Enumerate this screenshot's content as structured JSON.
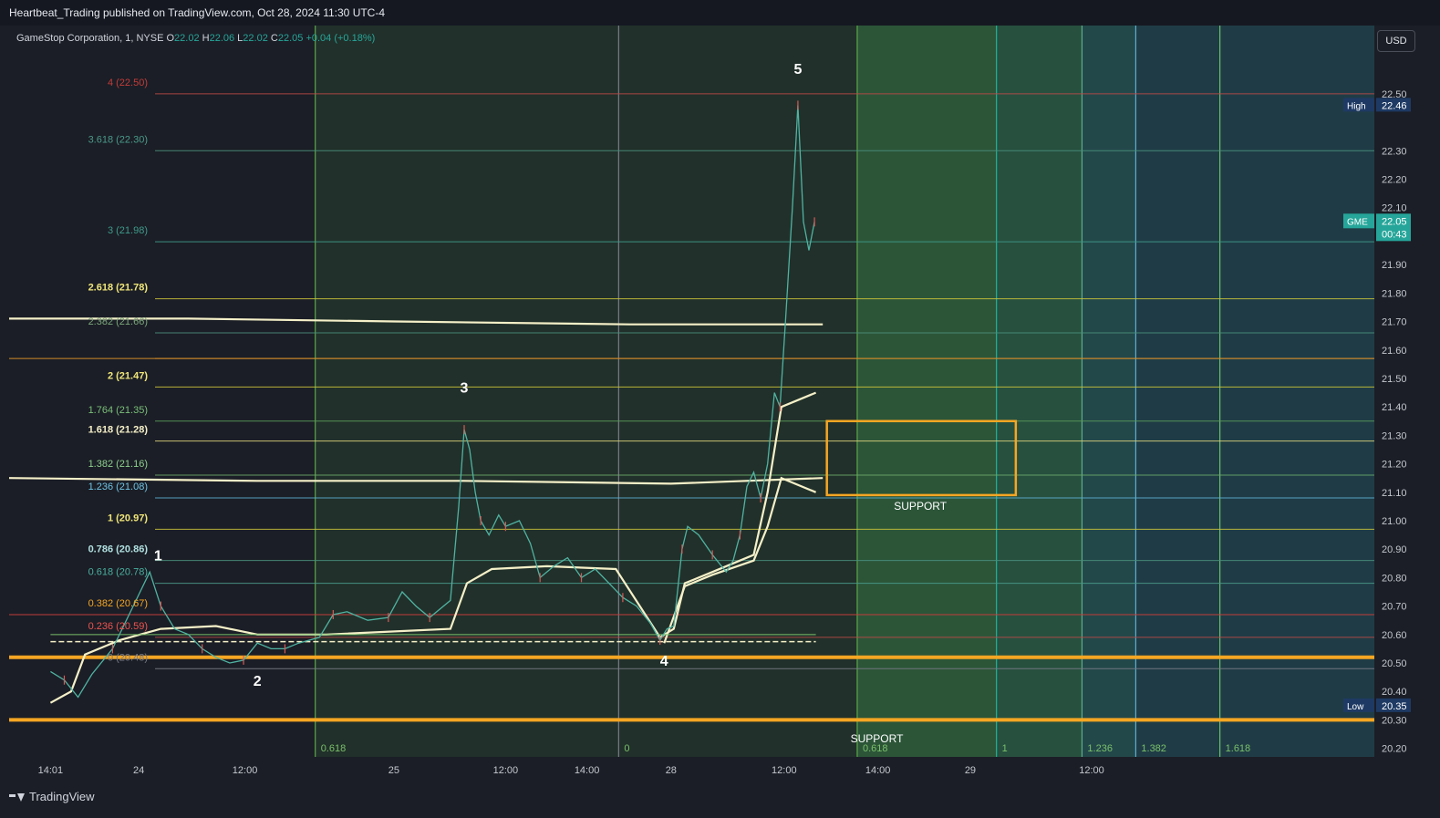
{
  "header": {
    "publish_line": "Heartbeat_Trading published on TradingView.com, Oct 28, 2024 11:30 UTC-4"
  },
  "legend": {
    "symbol": "GameStop Corporation, 1, NYSE",
    "o_label": "O",
    "o_value": "22.02",
    "h_label": "H",
    "h_value": "22.06",
    "l_label": "L",
    "l_value": "22.02",
    "c_label": "C",
    "c_value": "22.05",
    "change": "+0.04 (+0.18%)"
  },
  "currency_button": "USD",
  "footer": {
    "brand": "TradingView"
  },
  "colors": {
    "background": "#1b1e26",
    "up": "#26a69a",
    "down": "#ef5350",
    "support": "#f5a623",
    "vwap": "#f5f0c8",
    "green_zone": "#3d5c3f",
    "teal_zone": "#1f4f55"
  },
  "chart_data": {
    "type": "line",
    "title": "",
    "symbol": "GME",
    "interval": "1",
    "ylim": [
      20.17,
      22.74
    ],
    "y_ticks": [
      "22.50",
      "22.30",
      "22.20",
      "22.10",
      "22.00",
      "21.90",
      "21.80",
      "21.70",
      "21.60",
      "21.50",
      "21.40",
      "21.30",
      "21.20",
      "21.10",
      "21.00",
      "20.90",
      "20.80",
      "20.70",
      "20.60",
      "20.50",
      "20.40",
      "20.30",
      "20.20"
    ],
    "x_ticks": [
      {
        "label": "14:01",
        "x": 0.0
      },
      {
        "label": "24",
        "x": 0.64
      },
      {
        "label": "12:00",
        "x": 1.41
      },
      {
        "label": "25",
        "x": 2.49
      },
      {
        "label": "12:00",
        "x": 3.3
      },
      {
        "label": "14:00",
        "x": 3.89
      },
      {
        "label": "28",
        "x": 4.5
      },
      {
        "label": "12:00",
        "x": 5.32
      },
      {
        "label": "14:00",
        "x": 6.0
      },
      {
        "label": "29",
        "x": 6.67
      },
      {
        "label": "12:00",
        "x": 7.55
      }
    ],
    "x_range": [
      -0.3,
      9.6
    ],
    "price_path": [
      [
        0.0,
        20.47
      ],
      [
        0.1,
        20.44
      ],
      [
        0.2,
        20.38
      ],
      [
        0.3,
        20.46
      ],
      [
        0.45,
        20.55
      ],
      [
        0.6,
        20.7
      ],
      [
        0.72,
        20.82
      ],
      [
        0.8,
        20.7
      ],
      [
        0.9,
        20.62
      ],
      [
        1.0,
        20.6
      ],
      [
        1.1,
        20.55
      ],
      [
        1.2,
        20.52
      ],
      [
        1.3,
        20.5
      ],
      [
        1.4,
        20.51
      ],
      [
        1.5,
        20.57
      ],
      [
        1.6,
        20.55
      ],
      [
        1.7,
        20.55
      ],
      [
        1.8,
        20.57
      ],
      [
        1.95,
        20.59
      ],
      [
        2.05,
        20.67
      ],
      [
        2.15,
        20.68
      ],
      [
        2.3,
        20.65
      ],
      [
        2.45,
        20.66
      ],
      [
        2.55,
        20.75
      ],
      [
        2.65,
        20.7
      ],
      [
        2.75,
        20.66
      ],
      [
        2.9,
        20.72
      ],
      [
        2.96,
        21.05
      ],
      [
        3.0,
        21.32
      ],
      [
        3.04,
        21.25
      ],
      [
        3.08,
        21.1
      ],
      [
        3.12,
        21.0
      ],
      [
        3.18,
        20.95
      ],
      [
        3.25,
        21.02
      ],
      [
        3.3,
        20.98
      ],
      [
        3.4,
        21.0
      ],
      [
        3.48,
        20.92
      ],
      [
        3.55,
        20.8
      ],
      [
        3.65,
        20.84
      ],
      [
        3.75,
        20.87
      ],
      [
        3.85,
        20.8
      ],
      [
        3.95,
        20.83
      ],
      [
        4.05,
        20.78
      ],
      [
        4.15,
        20.73
      ],
      [
        4.25,
        20.7
      ],
      [
        4.35,
        20.64
      ],
      [
        4.42,
        20.58
      ],
      [
        4.47,
        20.62
      ],
      [
        4.52,
        20.63
      ],
      [
        4.58,
        20.9
      ],
      [
        4.62,
        20.98
      ],
      [
        4.7,
        20.95
      ],
      [
        4.8,
        20.88
      ],
      [
        4.9,
        20.82
      ],
      [
        4.95,
        20.86
      ],
      [
        5.0,
        20.95
      ],
      [
        5.05,
        21.12
      ],
      [
        5.1,
        21.17
      ],
      [
        5.15,
        21.08
      ],
      [
        5.2,
        21.2
      ],
      [
        5.25,
        21.45
      ],
      [
        5.29,
        21.4
      ],
      [
        5.33,
        21.7
      ],
      [
        5.38,
        22.1
      ],
      [
        5.42,
        22.46
      ],
      [
        5.46,
        22.05
      ],
      [
        5.5,
        21.95
      ],
      [
        5.54,
        22.05
      ]
    ],
    "horizontal_levels": [
      {
        "price": 22.5,
        "color": "#b94a48"
      },
      {
        "price": 22.3,
        "color": "#4a8f7c"
      },
      {
        "price": 21.98,
        "color": "#3f9a8a"
      },
      {
        "price": 21.78,
        "color": "#c9c23a"
      },
      {
        "price": 21.66,
        "color": "#4a8f7c"
      },
      {
        "price": 21.57,
        "color": "#d48c2a"
      },
      {
        "price": 21.47,
        "color": "#c9c23a"
      },
      {
        "price": 21.35,
        "color": "#5a9a5a"
      },
      {
        "price": 21.28,
        "color": "#d8d07a"
      },
      {
        "price": 21.16,
        "color": "#6aa86a"
      },
      {
        "price": 21.08,
        "color": "#5aaed0"
      },
      {
        "price": 20.97,
        "color": "#c9c23a"
      },
      {
        "price": 20.86,
        "color": "#4a8f7c"
      },
      {
        "price": 20.78,
        "color": "#4a9a8a"
      },
      {
        "price": 20.67,
        "color": "#c23c3a"
      },
      {
        "price": 20.59,
        "color": "#b94a48"
      },
      {
        "price": 20.48,
        "color": "#787b86"
      }
    ],
    "fib_labels": [
      {
        "text": "4 (22.50)",
        "price": 22.5,
        "color": "#c23c3a"
      },
      {
        "text": "3.618 (22.30)",
        "price": 22.3,
        "color": "#4a9a8a"
      },
      {
        "text": "3 (21.98)",
        "price": 21.98,
        "color": "#3f9a8a"
      },
      {
        "text": "2.618 (21.78)",
        "price": 21.78,
        "color": "#f0e67a"
      },
      {
        "text": "2.382 (21.66)",
        "price": 21.66,
        "color": "#7aa67a"
      },
      {
        "text": "2 (21.47)",
        "price": 21.47,
        "color": "#f0e67a"
      },
      {
        "text": "1.764 (21.35)",
        "price": 21.35,
        "color": "#7abf7a"
      },
      {
        "text": "1.618 (21.28)",
        "price": 21.28,
        "color": "#f5f0c8"
      },
      {
        "text": "1.382 (21.16)",
        "price": 21.16,
        "color": "#8ed08e"
      },
      {
        "text": "1.236 (21.08)",
        "price": 21.08,
        "color": "#6ec4e6"
      },
      {
        "text": "1 (20.97)",
        "price": 20.97,
        "color": "#f0e67a"
      },
      {
        "text": "0.786 (20.86)",
        "price": 20.86,
        "color": "#b0e0e0"
      },
      {
        "text": "0.618 (20.78)",
        "price": 20.78,
        "color": "#4ab0a0"
      },
      {
        "text": "0.382 (20.67)",
        "price": 20.67,
        "color": "#f5a623"
      },
      {
        "text": "0.236 (20.59)",
        "price": 20.59,
        "color": "#ef5350"
      },
      {
        "text": "0 (20.48)",
        "price": 20.48,
        "color": "#787b86"
      }
    ],
    "wave_labels": [
      {
        "text": "1",
        "x": 0.78,
        "price": 20.86
      },
      {
        "text": "2",
        "x": 1.5,
        "price": 20.42
      },
      {
        "text": "3",
        "x": 3.0,
        "price": 21.45
      },
      {
        "text": "4",
        "x": 4.45,
        "price": 20.49
      },
      {
        "text": "5",
        "x": 5.42,
        "price": 22.57
      }
    ],
    "support_lines": [
      {
        "price": 20.52
      },
      {
        "price": 20.3
      }
    ],
    "support_box": {
      "x0": 5.63,
      "x1": 7.0,
      "y0": 21.09,
      "y1": 21.35,
      "label": "SUPPORT"
    },
    "support_label_2": {
      "text": "SUPPORT",
      "x": 6.0,
      "price": 20.26
    },
    "vertical_lines": [
      {
        "x": 1.92,
        "color": "#5aa84a"
      },
      {
        "x": 4.12,
        "color": "#787b86"
      },
      {
        "x": 5.85,
        "color": "#5aa84a"
      },
      {
        "x": 6.86,
        "color": "#1fb39a"
      },
      {
        "x": 7.48,
        "color": "#5ab08a"
      },
      {
        "x": 7.87,
        "color": "#5aaed0"
      },
      {
        "x": 8.48,
        "color": "#6ac06a"
      }
    ],
    "time_fib_labels": [
      {
        "text": "0.618",
        "x": 1.92
      },
      {
        "text": "0",
        "x": 4.12
      },
      {
        "text": "0.618",
        "x": 5.85
      },
      {
        "text": "1",
        "x": 6.86
      },
      {
        "text": "1.236",
        "x": 7.48
      },
      {
        "text": "1.382",
        "x": 7.87
      },
      {
        "text": "1.618",
        "x": 8.48
      }
    ],
    "vwap_lines": [
      {
        "points": [
          [
            -0.3,
            21.71
          ],
          [
            1.0,
            21.71
          ],
          [
            2.5,
            21.7
          ],
          [
            4.2,
            21.69
          ],
          [
            5.6,
            21.69
          ]
        ]
      },
      {
        "points": [
          [
            -0.3,
            21.15
          ],
          [
            1.5,
            21.14
          ],
          [
            3.0,
            21.14
          ],
          [
            4.5,
            21.13
          ],
          [
            5.6,
            21.15
          ]
        ]
      },
      {
        "points": [
          [
            0.0,
            20.36
          ],
          [
            0.15,
            20.4
          ],
          [
            0.25,
            20.53
          ],
          [
            0.5,
            20.58
          ],
          [
            0.8,
            20.62
          ],
          [
            1.2,
            20.63
          ],
          [
            1.5,
            20.6
          ],
          [
            2.0,
            20.6
          ],
          [
            2.9,
            20.62
          ],
          [
            3.02,
            20.78
          ],
          [
            3.2,
            20.83
          ],
          [
            3.6,
            20.84
          ],
          [
            4.1,
            20.83
          ],
          [
            4.42,
            20.59
          ],
          [
            4.52,
            20.62
          ],
          [
            4.6,
            20.78
          ],
          [
            4.8,
            20.82
          ],
          [
            5.1,
            20.88
          ],
          [
            5.2,
            21.1
          ],
          [
            5.3,
            21.4
          ],
          [
            5.55,
            21.45
          ]
        ]
      },
      {
        "points": [
          [
            4.45,
            20.57
          ],
          [
            4.6,
            20.77
          ],
          [
            4.8,
            20.81
          ],
          [
            5.1,
            20.86
          ],
          [
            5.2,
            20.98
          ],
          [
            5.3,
            21.15
          ],
          [
            5.55,
            21.1
          ]
        ]
      }
    ],
    "price_tags": [
      {
        "label": "High",
        "value": "22.46",
        "price": 22.46
      },
      {
        "label": "GME",
        "value": "22.05",
        "extra": "00:43",
        "price": 22.05
      },
      {
        "label": "Low",
        "value": "20.35",
        "price": 20.35
      }
    ]
  }
}
